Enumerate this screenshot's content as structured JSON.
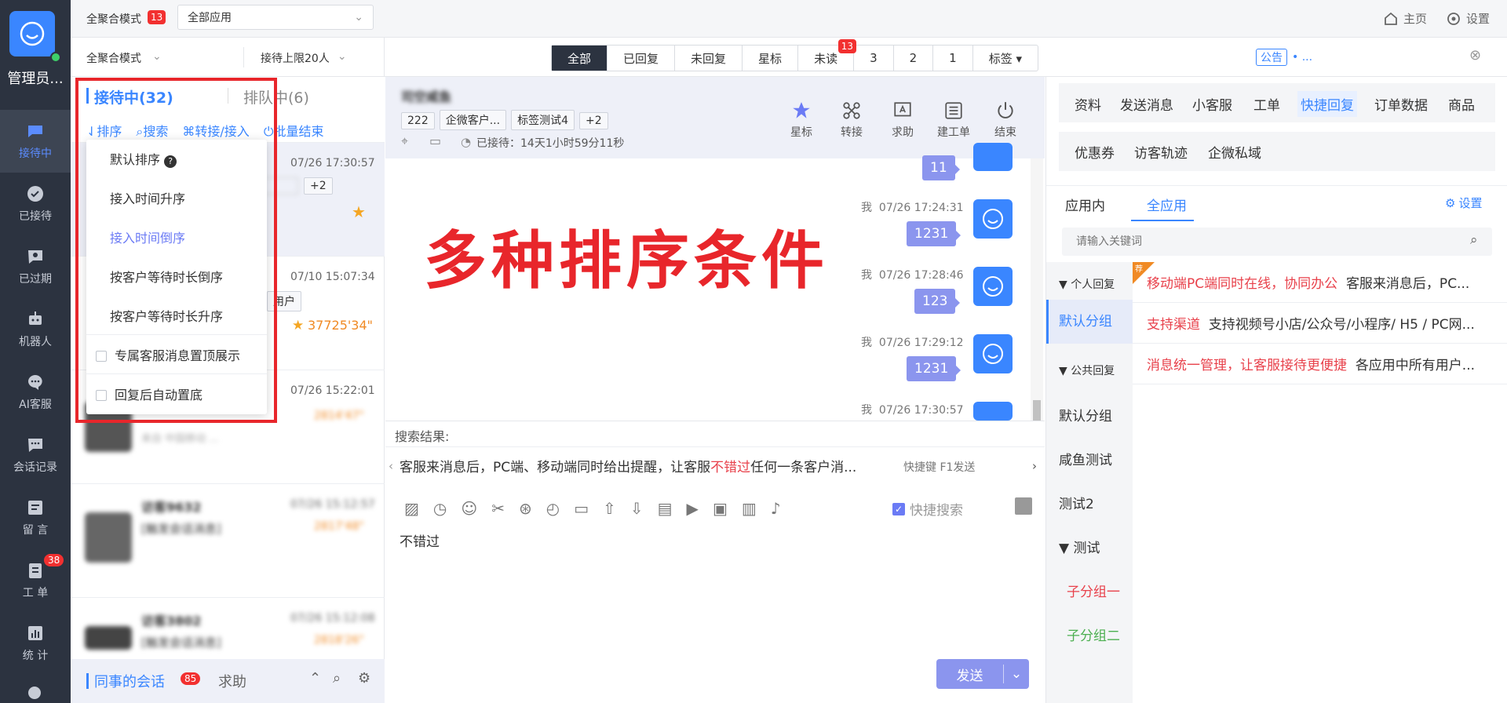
{
  "nav": {
    "user": "管理员...",
    "items": [
      {
        "label": "接待中",
        "icon": "chat-icon"
      },
      {
        "label": "已接待",
        "icon": "check-circle-icon"
      },
      {
        "label": "已过期",
        "icon": "expired-icon"
      },
      {
        "label": "机器人",
        "icon": "robot-icon"
      },
      {
        "label": "AI客服",
        "icon": "ai-chat-icon"
      },
      {
        "label": "会话记录",
        "icon": "history-icon"
      },
      {
        "label": "留 言",
        "icon": "message-icon"
      },
      {
        "label": "工 单",
        "icon": "ticket-icon",
        "badge": "38"
      },
      {
        "label": "统 计",
        "icon": "stats-icon"
      }
    ]
  },
  "topbar": {
    "mode_label": "全聚合模式",
    "mode_badge": "13",
    "app_select": "全部应用",
    "home": "主页",
    "settings": "设置"
  },
  "subbar": {
    "mode_select": "全聚合模式",
    "limit_select": "接待上限20人",
    "filters": [
      {
        "label": "全部",
        "active": true
      },
      {
        "label": "已回复"
      },
      {
        "label": "未回复"
      },
      {
        "label": "星标"
      },
      {
        "label": "未读",
        "badge": "13"
      },
      {
        "label": "3"
      },
      {
        "label": "2"
      },
      {
        "label": "1"
      },
      {
        "label": "标签 ▾"
      }
    ],
    "notice_tag": "公告",
    "notice_text": "• ..."
  },
  "list": {
    "tab_active": "接待中(32)",
    "tab_queue": "排队中(6)",
    "actions": [
      "⇃排序",
      "搜索",
      "转接/接入",
      "批量结束"
    ],
    "convs": [
      {
        "time": "07/26 17:30:57",
        "tag": "+2"
      },
      {
        "time": "07/10 15:07:34",
        "tag": "用户",
        "wait": "37725'34\""
      },
      {
        "time": "07/26 15:22:01",
        "wait": "2814'47\"",
        "line": "来自 中国移动 ...",
        "name": ""
      },
      {
        "name": "访客9632",
        "time": "07/26 15:12:57",
        "wait": "2817'48\"",
        "line": "[触发会话消息]"
      },
      {
        "name": "访客3802",
        "time": "07/26 15:12:08",
        "wait": "2818'26\"",
        "line": "[触发会话消息]"
      }
    ],
    "footer_tab": "同事的会话",
    "footer_badge": "85",
    "footer_help": "求助"
  },
  "dropdown": {
    "items": [
      "默认排序",
      "接入时间升序",
      "接入时间倒序",
      "按客户等待时长倒序",
      "按客户等待时长升序"
    ],
    "active_index": 2,
    "checks": [
      "专属客服消息置顶展示",
      "回复后自动置底"
    ]
  },
  "annotation": "多种排序条件",
  "chat": {
    "name": "司空咸鱼",
    "tags": [
      "222",
      "企微客户...",
      "标签测试4",
      "+2"
    ],
    "waited": "已接待：14天1小时59分11秒",
    "actions": [
      {
        "label": "星标",
        "icon": "star-icon"
      },
      {
        "label": "转接",
        "icon": "transfer-icon"
      },
      {
        "label": "求助",
        "icon": "help-icon"
      },
      {
        "label": "建工单",
        "icon": "ticket-icon"
      },
      {
        "label": "结束",
        "icon": "power-icon"
      }
    ],
    "messages": [
      {
        "text": "11"
      },
      {
        "who": "我",
        "time": "07/26 17:24:31",
        "text": "1231"
      },
      {
        "who": "我",
        "time": "07/26 17:28:46",
        "text": "123"
      },
      {
        "who": "我",
        "time": "07/26 17:29:12",
        "text": "1231"
      },
      {
        "who": "我",
        "time": "07/26 17:30:57",
        "text": ""
      }
    ]
  },
  "search": {
    "label": "搜索结果:",
    "result_pre": "客服来消息后，PC端、移动端同时给出提醒，让客服",
    "result_hl": "不错过",
    "result_post": "任何一条客户消...",
    "shortcut": "快捷键 F1发送"
  },
  "editor": {
    "quick_search": "快捷搜索",
    "text": "不错过",
    "send": "发送"
  },
  "right": {
    "tabs_row1": [
      "资料",
      "发送消息",
      "小客服",
      "工单",
      "快捷回复",
      "订单数据",
      "商品"
    ],
    "active_tab": "快捷回复",
    "tabs_row2": [
      "优惠券",
      "访客轨迹",
      "企微私域"
    ],
    "scope_tabs": [
      "应用内",
      "全应用"
    ],
    "scope_active": "全应用",
    "settings": "设置",
    "search_placeholder": "请输入关键词",
    "groups": [
      {
        "label": "▼ 个人回复",
        "type": "head"
      },
      {
        "label": "默认分组",
        "type": "active"
      },
      {
        "label": "▼ 公共回复",
        "type": "head"
      },
      {
        "label": "默认分组"
      },
      {
        "label": "咸鱼测试"
      },
      {
        "label": "测试2"
      },
      {
        "label": "▼ 测试"
      },
      {
        "label": "子分组一",
        "color": "#e8414b"
      },
      {
        "label": "子分组二",
        "color": "#4caf50"
      }
    ],
    "replies": [
      {
        "title": "移动端PC端同时在线，协同办公",
        "body": "客服来消息后，PC..."
      },
      {
        "title": "支持渠道",
        "body": "支持视频号小店/公众号/小程序/ H5 / PC网..."
      },
      {
        "title": "消息统一管理，让客服接待更便捷",
        "body": "各应用中所有用户..."
      }
    ],
    "hot_badge": "荐"
  }
}
